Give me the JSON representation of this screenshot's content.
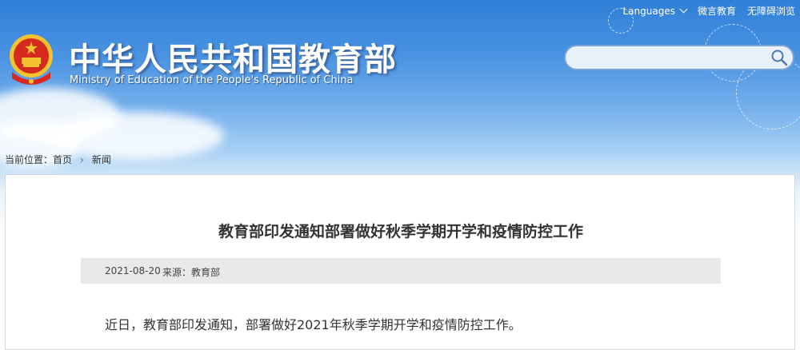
{
  "header": {
    "languages_label": "Languages",
    "wechat_label": "微言教育",
    "accessible_label": "无障碍浏览",
    "title_cn": "中华人民共和国教育部",
    "title_en": "Ministry of Education of the People's Republic of China",
    "search": {
      "value": "",
      "placeholder": ""
    }
  },
  "breadcrumb": {
    "prefix": "当前位置：",
    "home": "首页",
    "current": "新闻"
  },
  "article": {
    "title": "教育部印发通知部署做好秋季学期开学和疫情防控工作",
    "date": "2021-08-20",
    "source": "来源：教育部",
    "first_paragraph": "近日，教育部印发通知，部署做好2021年秋季学期开学和疫情防控工作。"
  },
  "colors": {
    "sky": "#4d95e3",
    "emblem_red": "#d62a1e",
    "emblem_gold": "#f4c430"
  }
}
